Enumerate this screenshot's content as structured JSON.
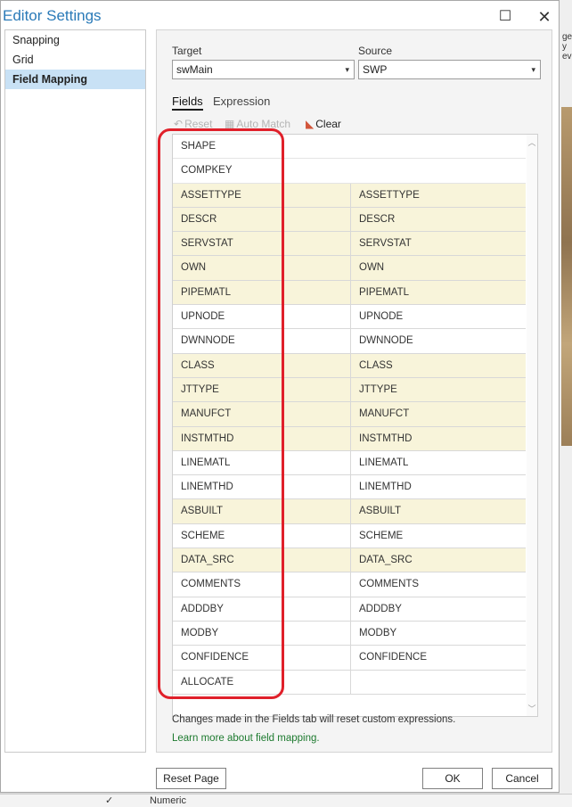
{
  "window": {
    "title": "Editor Settings",
    "maximize_icon": "maximize-icon",
    "close_icon": "close-icon",
    "maximize_glyph": "☐",
    "close_glyph": "✕"
  },
  "sidebar": {
    "items": [
      {
        "label": "Snapping",
        "selected": false
      },
      {
        "label": "Grid",
        "selected": false
      },
      {
        "label": "Field Mapping",
        "selected": true
      }
    ]
  },
  "mapping": {
    "target_label": "Target",
    "target_value": "swMain",
    "source_label": "Source",
    "source_value": "SWP",
    "tabs": [
      {
        "label": "Fields",
        "active": true
      },
      {
        "label": "Expression",
        "active": false
      }
    ],
    "toolbar": {
      "reset": "Reset",
      "auto_match": "Auto Match",
      "clear": "Clear"
    },
    "rows": [
      {
        "target": "SHAPE",
        "source": "",
        "matched": false
      },
      {
        "target": "COMPKEY",
        "source": "",
        "matched": false
      },
      {
        "target": "ASSETTYPE",
        "source": "ASSETTYPE",
        "matched": true
      },
      {
        "target": "DESCR",
        "source": "DESCR",
        "matched": true
      },
      {
        "target": "SERVSTAT",
        "source": "SERVSTAT",
        "matched": true
      },
      {
        "target": "OWN",
        "source": "OWN",
        "matched": true
      },
      {
        "target": "PIPEMATL",
        "source": "PIPEMATL",
        "matched": true
      },
      {
        "target": "UPNODE",
        "source": "UPNODE",
        "matched": false
      },
      {
        "target": "DWNNODE",
        "source": "DWNNODE",
        "matched": false
      },
      {
        "target": "CLASS",
        "source": "CLASS",
        "matched": true
      },
      {
        "target": "JTTYPE",
        "source": "JTTYPE",
        "matched": true
      },
      {
        "target": "MANUFCT",
        "source": "MANUFCT",
        "matched": true
      },
      {
        "target": "INSTMTHD",
        "source": "INSTMTHD",
        "matched": true
      },
      {
        "target": "LINEMATL",
        "source": "LINEMATL",
        "matched": false
      },
      {
        "target": "LINEMTHD",
        "source": "LINEMTHD",
        "matched": false
      },
      {
        "target": "ASBUILT",
        "source": "ASBUILT",
        "matched": true
      },
      {
        "target": "SCHEME",
        "source": "SCHEME",
        "matched": false
      },
      {
        "target": "DATA_SRC",
        "source": "DATA_SRC",
        "matched": true
      },
      {
        "target": "COMMENTS",
        "source": "COMMENTS",
        "matched": false
      },
      {
        "target": "ADDDBY",
        "source": "ADDDBY",
        "matched": false
      },
      {
        "target": "MODBY",
        "source": "MODBY",
        "matched": false
      },
      {
        "target": "CONFIDENCE",
        "source": "CONFIDENCE",
        "matched": false
      },
      {
        "target": "ALLOCATE",
        "source": "",
        "matched": false
      }
    ],
    "info_text": "Changes made in the Fields tab will reset custom expressions.",
    "learn_more_link": "Learn more about field mapping."
  },
  "footer": {
    "reset_page": "Reset Page",
    "ok": "OK",
    "cancel": "Cancel"
  },
  "background": {
    "peek_text_1": "ge",
    "peek_text_2": "y",
    "peek_text_3": "ev",
    "bottom_text": "Numeric",
    "bottom_check": "✓"
  },
  "colors": {
    "accent": "#2a7ab8",
    "selected_nav": "#c8e1f5",
    "matched_row": "#f8f4da",
    "highlight": "#e0202a",
    "link": "#1d7a2f"
  }
}
